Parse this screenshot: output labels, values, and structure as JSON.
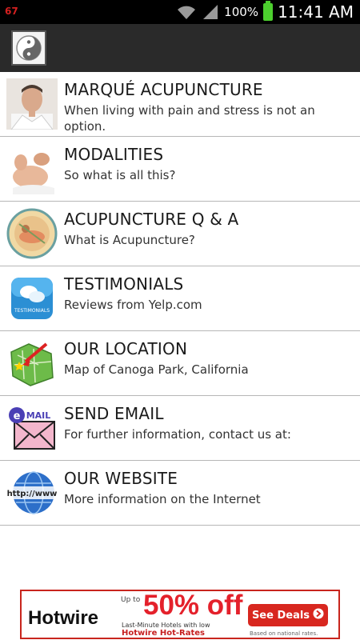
{
  "status_bar": {
    "notification_count": "67",
    "battery_percent": "100%",
    "time": "11:41 AM",
    "icons": [
      "wifi-icon",
      "signal-icon",
      "battery-icon"
    ]
  },
  "app": {
    "icon": "yin-yang-icon"
  },
  "menu": {
    "items": [
      {
        "title": "MARQUÉ ACUPUNCTURE",
        "subtitle": "When living with pain and stress is not an option.",
        "icon": "doctor-photo"
      },
      {
        "title": "MODALITIES",
        "subtitle": "So what is all this?",
        "icon": "massage-photo"
      },
      {
        "title": "ACUPUNCTURE Q & A",
        "subtitle": "What is Acupuncture?",
        "icon": "acupuncture-emblem"
      },
      {
        "title": "TESTIMONIALS",
        "subtitle": "Reviews from Yelp.com",
        "icon": "testimonials-icon"
      },
      {
        "title": "OUR LOCATION",
        "subtitle": "Map of Canoga Park, California",
        "icon": "map-icon"
      },
      {
        "title": "SEND EMAIL",
        "subtitle": "For further information, contact us at:",
        "icon": "email-icon"
      },
      {
        "title": "OUR WEBSITE",
        "subtitle": "More information on the Internet",
        "icon": "globe-icon"
      }
    ]
  },
  "ad": {
    "brand": "Hotwire",
    "up_to": "Up to",
    "headline": "50% off",
    "subline": "Last-Minute Hotels with low",
    "subline2": "Hotwire Hot-Rates",
    "cta": "See Deals",
    "note": "Based on national rates."
  },
  "colors": {
    "status_bar": "#000000",
    "action_bar": "#2a2a2a",
    "divider": "#b7b7b7",
    "battery": "#4ccf2e",
    "ad_red": "#e4212b"
  }
}
